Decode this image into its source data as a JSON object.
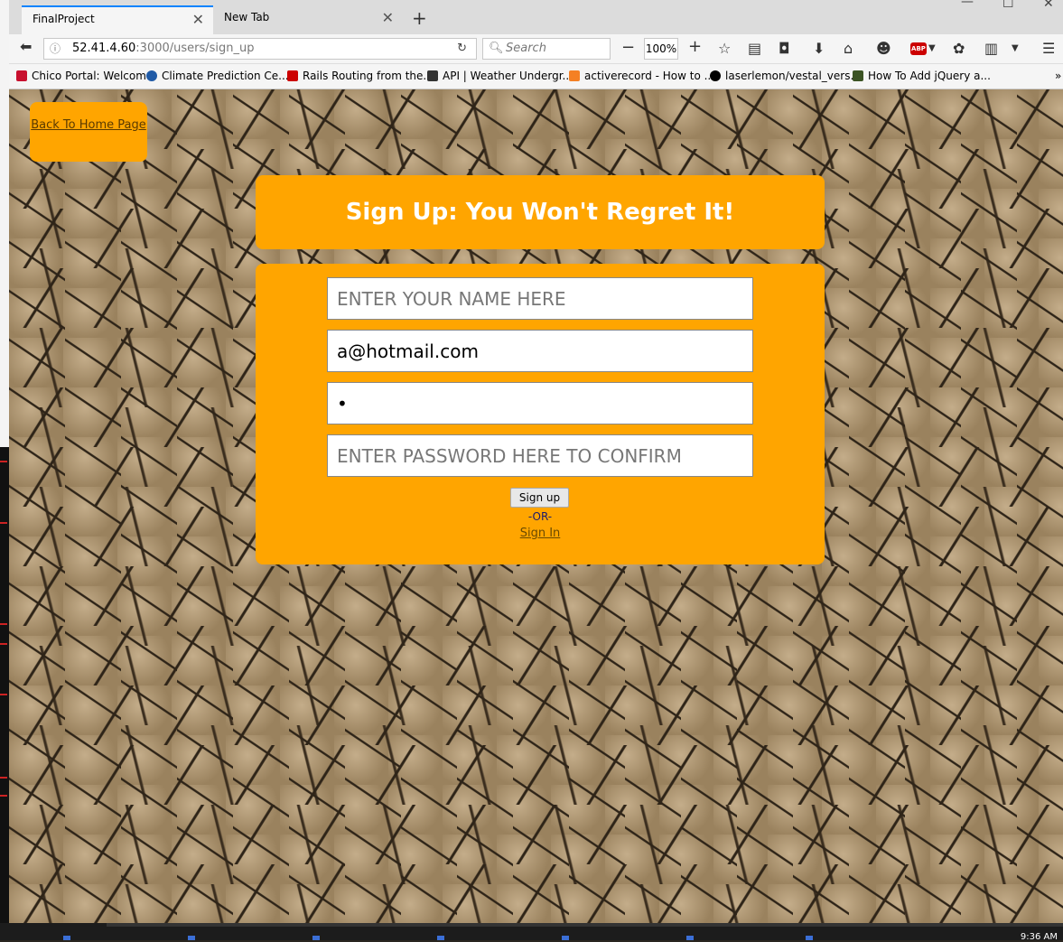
{
  "browser": {
    "tabs": [
      {
        "title": "FinalProject",
        "active": true
      },
      {
        "title": "New Tab",
        "active": false
      }
    ],
    "new_tab_symbol": "+",
    "url_host": "52.41.4.60",
    "url_path": ":3000/users/sign_up",
    "search_placeholder": "Search",
    "zoom_level": "100%",
    "bookmarks": [
      {
        "label": "Chico Portal: Welcome",
        "icon": "chico-icon",
        "color": "#c8102e"
      },
      {
        "label": "Climate Prediction Ce...",
        "icon": "noaa-icon",
        "color": "#1f5aa6"
      },
      {
        "label": "Rails Routing from the...",
        "icon": "rails-icon",
        "color": "#cc0000"
      },
      {
        "label": "API | Weather Undergr...",
        "icon": "weather-icon",
        "color": "#333333"
      },
      {
        "label": "activerecord - How to ...",
        "icon": "stackoverflow-icon",
        "color": "#f48024"
      },
      {
        "label": "laserlemon/vestal_vers...",
        "icon": "github-icon",
        "color": "#000000"
      },
      {
        "label": "How To Add jQuery a...",
        "icon": "bs-icon",
        "color": "#3b5323"
      }
    ]
  },
  "page": {
    "back_link": "Back To Home Page",
    "heading": "Sign Up: You Won't Regret It!",
    "form": {
      "name_placeholder": "ENTER YOUR NAME HERE",
      "email_value": "a@hotmail.com",
      "password_value": "•",
      "confirm_placeholder": "ENTER PASSWORD HERE TO CONFIRM",
      "submit_label": "Sign up",
      "or_text": "-OR-",
      "signin_link": "Sign In"
    }
  },
  "taskbar": {
    "clock": "9:36 AM"
  },
  "colors": {
    "accent": "#ffa500",
    "tab_indicator": "#0a84ff"
  }
}
